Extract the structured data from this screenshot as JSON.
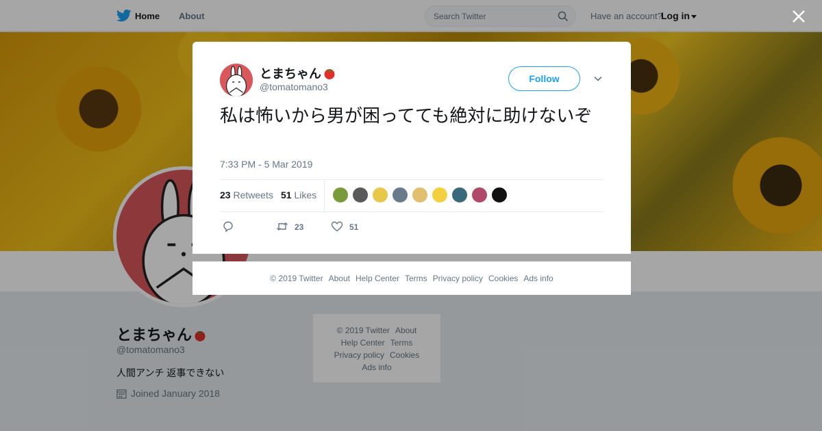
{
  "topbar": {
    "home_label": "Home",
    "about_label": "About",
    "search_placeholder": "Search Twitter",
    "account_prompt": "Have an account?",
    "login_label": "Log in"
  },
  "profile": {
    "name": "とまちゃん",
    "handle": "@tomatomano3",
    "bio": "人間アンチ 返事できない",
    "joined": "Joined January 2018"
  },
  "side_footer": {
    "row1": [
      "© 2019 Twitter",
      "About"
    ],
    "row2": [
      "Help Center",
      "Terms"
    ],
    "row3": [
      "Privacy policy",
      "Cookies"
    ],
    "row4": [
      "Ads info"
    ]
  },
  "tweet": {
    "name": "とまちゃん",
    "handle": "@tomatomano3",
    "follow_label": "Follow",
    "text": "私は怖いから男が困ってても絶対に助けないぞ",
    "timestamp": "7:33 PM - 5 Mar 2019",
    "retweets_count": "23",
    "retweets_label": "Retweets",
    "likes_count": "51",
    "likes_label": "Likes",
    "action_retweet_count": "23",
    "action_like_count": "51",
    "liker_colors": [
      "#7a9b3a",
      "#5a5a5a",
      "#e8c84a",
      "#6b7a8a",
      "#e0c070",
      "#f4d040",
      "#3a6a7a",
      "#b04a6a",
      "#111111"
    ]
  },
  "modal_footer": [
    "© 2019 Twitter",
    "About",
    "Help Center",
    "Terms",
    "Privacy policy",
    "Cookies",
    "Ads info"
  ],
  "colors": {
    "twitter_blue": "#1da1f2",
    "avatar_red": "#d9585c",
    "muted_text": "#657786"
  }
}
